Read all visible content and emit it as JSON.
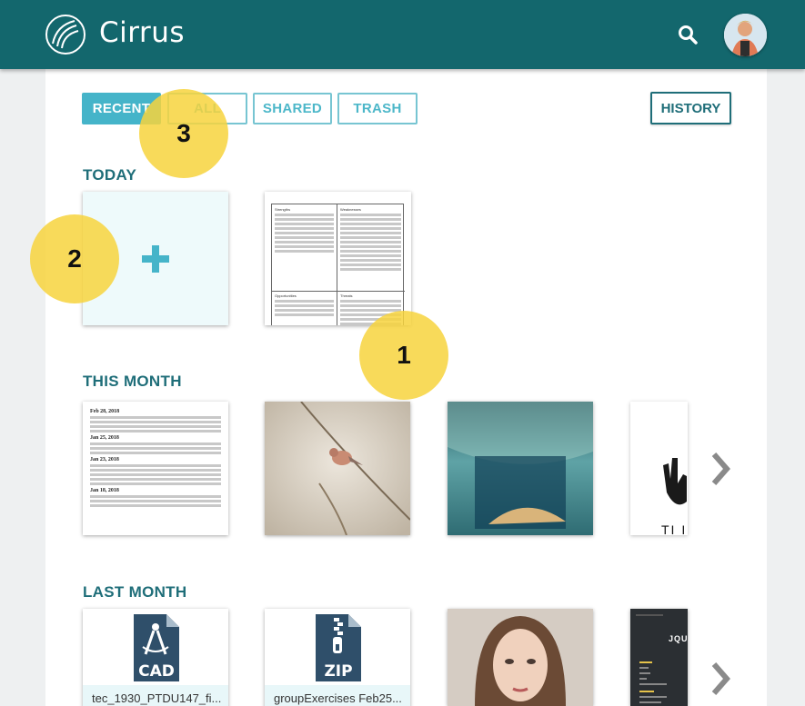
{
  "app": {
    "name": "Cirrus"
  },
  "tabs": [
    {
      "label": "RECENT",
      "active": true
    },
    {
      "label": "ALL",
      "active": false
    },
    {
      "label": "SHARED",
      "active": false
    },
    {
      "label": "TRASH",
      "active": false
    }
  ],
  "history_label": "HISTORY",
  "sections": {
    "today": "TODAY",
    "this_month": "THIS MONTH",
    "last_month": "LAST MONTH"
  },
  "swot": {
    "strengths_title": "Strengths",
    "weaknesses_title": "Weaknesses",
    "opportunities_title": "Opportunities",
    "threats_title": "Threats"
  },
  "notes": {
    "h1": "Feb 28, 2018",
    "h2": "Jan 25, 2018",
    "h3": "Jan 23, 2018",
    "h4": "Jan 18, 2018"
  },
  "files": [
    {
      "name": "tec_1930_PTDU147_fi...",
      "type": "CAD"
    },
    {
      "name": "groupExercises Feb25...",
      "type": "ZIP"
    }
  ],
  "code_card_title": "JQUE",
  "partial_card_text": "TI I",
  "bubbles": [
    "1",
    "2",
    "3"
  ],
  "colors": {
    "header": "#13676d",
    "accent": "#45b4c9",
    "highlight": "#f7d33d"
  }
}
